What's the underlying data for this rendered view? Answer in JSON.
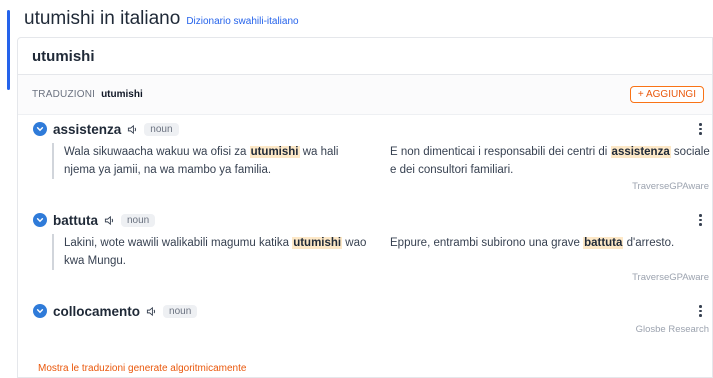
{
  "header": {
    "title": "utumishi in italiano",
    "subtitle": "Dizionario swahili-italiano"
  },
  "term": "utumishi",
  "translations_section": {
    "label": "TRADUZIONI",
    "term": "utumishi",
    "add_button": "+ AGGIUNGI"
  },
  "entries": [
    {
      "word": "assistenza",
      "pos": "noun",
      "example_src": [
        "Wala sikuwaacha wakuu wa ofisi za ",
        "utumishi",
        " wa hali njema ya jamii, na wa mambo ya familia."
      ],
      "example_tgt": [
        "E non dimenticai i responsabili dei centri di ",
        "assistenza",
        " sociale e dei consultori familiari."
      ],
      "credit": "TraverseGPAware"
    },
    {
      "word": "battuta",
      "pos": "noun",
      "example_src": [
        "Lakini, wote wawili walikabili magumu katika ",
        "utumishi",
        " wao kwa Mungu."
      ],
      "example_tgt": [
        "Eppure, entrambi subirono una grave ",
        "battuta",
        " d'arresto."
      ],
      "credit": "TraverseGPAware"
    },
    {
      "word": "collocamento",
      "pos": "noun",
      "credit": "Glosbe Research"
    }
  ],
  "footer_link": "Mostra le traduzioni generate algoritmicamente",
  "colors": {
    "accent": "#2563eb",
    "orange": "#ea580c",
    "highlight": "#fde8c7"
  }
}
